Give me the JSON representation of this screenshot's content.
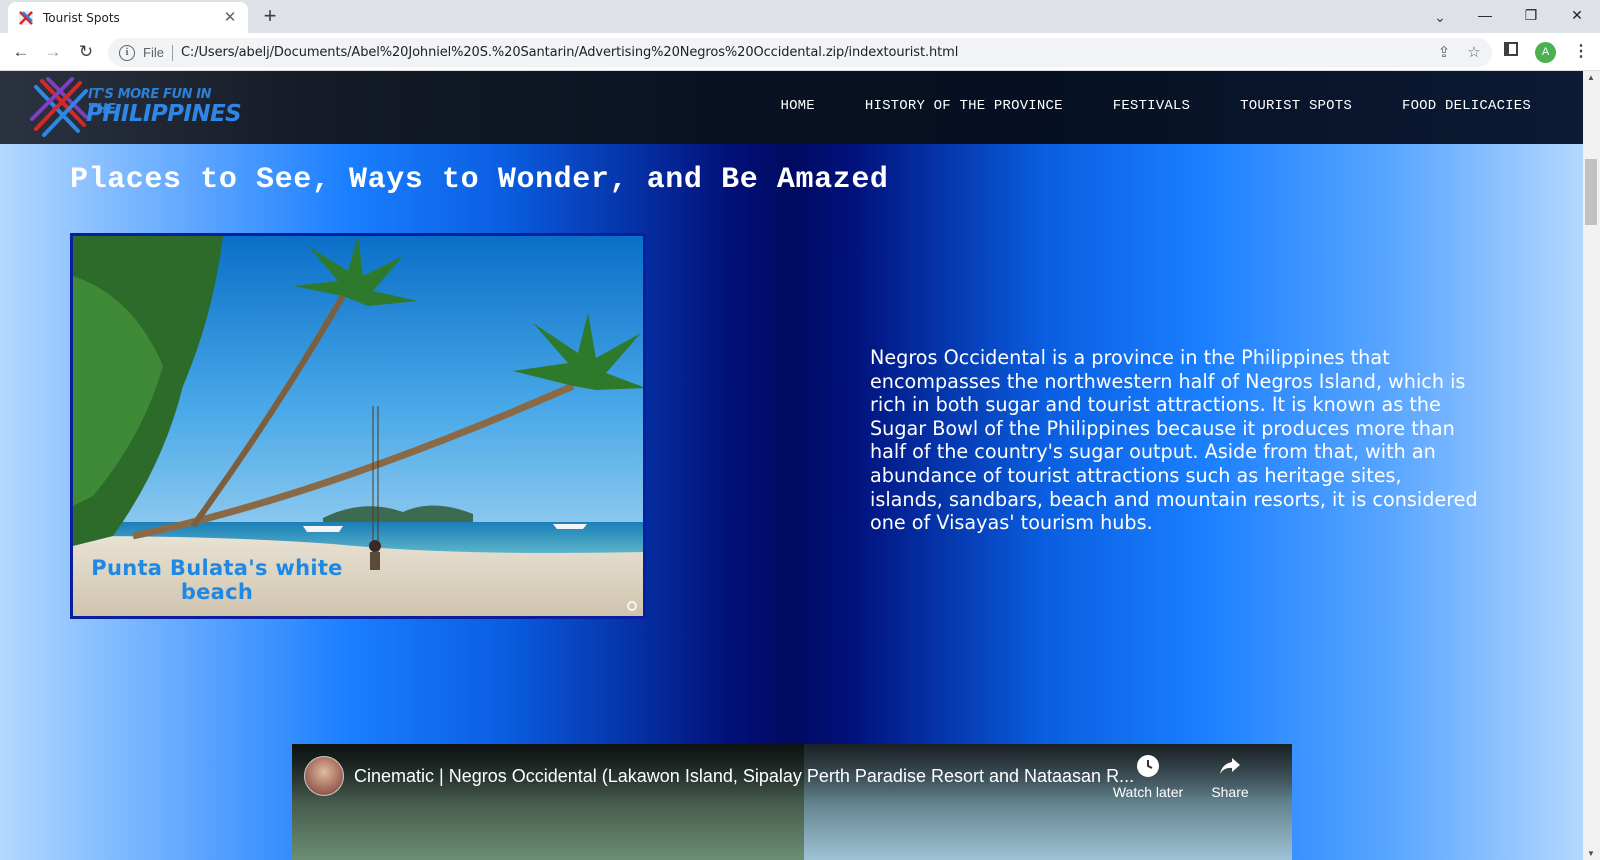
{
  "browser": {
    "tab_title": "Tourist Spots",
    "tab_close": "✕",
    "new_tab": "+",
    "file_label": "File",
    "url": "C:/Users/abelj/Documents/Abel%20Johniel%20S.%20Santarin/Advertising%20Negros%20Occidental.zip/indextourist.html",
    "profile_initial": "A",
    "icons": [
      "back-arrow-icon",
      "forward-arrow-icon",
      "reload-icon",
      "info-icon",
      "share-icon",
      "star-icon",
      "side-panel-icon",
      "kebab-menu-icon"
    ]
  },
  "site": {
    "logo_line1": "IT'S MORE FUN IN THE",
    "logo_line2": "PHILIPPINES",
    "nav": [
      "HOME",
      "HISTORY OF THE PROVINCE",
      "FESTIVALS",
      "TOURIST SPOTS",
      "FOOD DELICACIES"
    ],
    "headline": "Places to See, Ways to Wonder, and Be Amazed",
    "photo_caption_line1": "Punta Bulata's white",
    "photo_caption_line2": "beach",
    "description": "Negros Occidental is a province in the Philippines that encompasses the northwestern half of Negros Island, which is rich in both sugar and tourist attractions. It is known as the Sugar Bowl of the Philippines because it produces more than half of the country's sugar output. Aside from that, with an abundance of tourist attractions such as heritage sites, islands, sandbars, beach and mountain resorts, it is considered one of Visayas' tourism hubs.",
    "video": {
      "title": "Cinematic | Negros Occidental (Lakawon Island, Sipalay Perth Paradise Resort and Nataasan R...",
      "watch_later": "Watch later",
      "share": "Share"
    }
  },
  "colors": {
    "header_bg": "#0a1222",
    "accent_blue": "#1a7fff",
    "dark_navy": "#000a60",
    "logo_blue": "#2f86e6"
  }
}
